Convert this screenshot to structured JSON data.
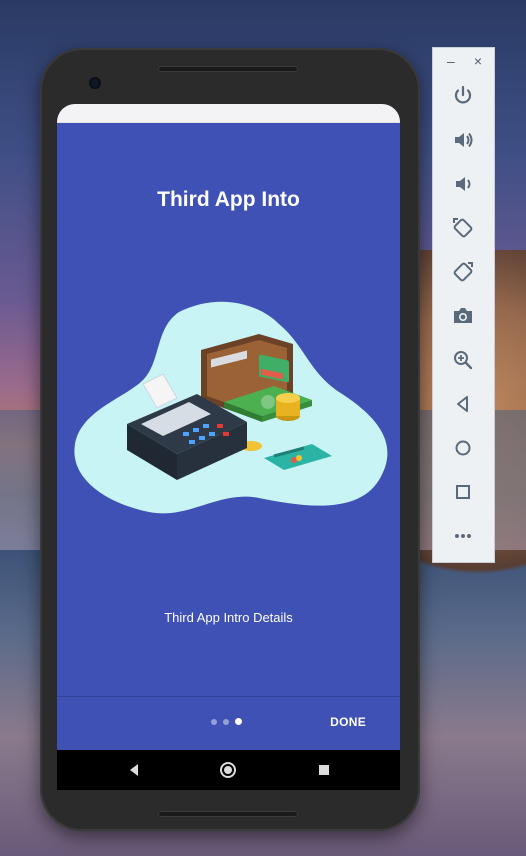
{
  "app": {
    "title": "Third App Into",
    "details": "Third App Intro Details",
    "done_label": "DONE",
    "pager": {
      "count": 3,
      "active_index": 2
    }
  },
  "emulator_sidebar": {
    "minimize_label": "–",
    "close_label": "×",
    "tools": [
      {
        "name": "power-icon"
      },
      {
        "name": "volume-up-icon"
      },
      {
        "name": "volume-down-icon"
      },
      {
        "name": "rotate-left-icon"
      },
      {
        "name": "rotate-right-icon"
      },
      {
        "name": "camera-icon"
      },
      {
        "name": "zoom-icon"
      },
      {
        "name": "back-icon"
      },
      {
        "name": "home-icon"
      },
      {
        "name": "overview-icon"
      },
      {
        "name": "more-icon"
      }
    ]
  },
  "colors": {
    "screen_bg": "#3f51b5",
    "blob": "#c8f4f6",
    "accent": "#ffffff"
  }
}
